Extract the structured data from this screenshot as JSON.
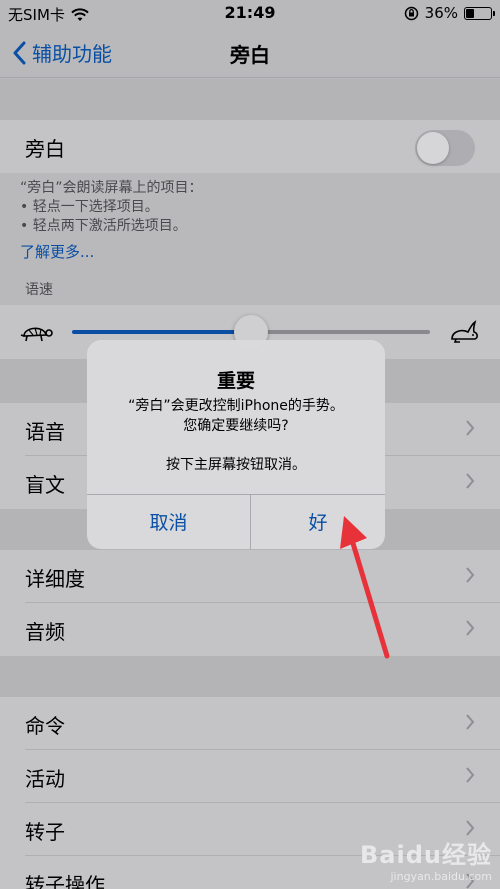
{
  "status_bar": {
    "carrier": "无SIM卡",
    "time": "21:49",
    "battery_percent": "36%",
    "battery_level": 0.36,
    "icons": [
      "wifi-icon",
      "orientation-lock-icon",
      "battery-icon"
    ]
  },
  "nav": {
    "back_label": "辅助功能",
    "title": "旁白"
  },
  "voiceover_row": {
    "label": "旁白",
    "toggle_on": false
  },
  "footer": {
    "line1": "“旁白”会朗读屏幕上的项目：",
    "line2": "• 轻点一下选择项目。",
    "line3": "• 轻点两下激活所选项目。",
    "learn_more": "了解更多..."
  },
  "speaking_rate": {
    "label": "语速",
    "value": 0.5
  },
  "rows_group1": [
    {
      "label": "语音"
    },
    {
      "label": "盲文"
    }
  ],
  "rows_group2": [
    {
      "label": "详细度"
    },
    {
      "label": "音频"
    }
  ],
  "rows_group3": [
    {
      "label": "命令"
    },
    {
      "label": "活动"
    },
    {
      "label": "转子"
    },
    {
      "label": "转子操作"
    }
  ],
  "alert": {
    "title": "重要",
    "message_line1": "“旁白”会更改控制iPhone的手势。",
    "message_line2": "您确定要继续吗?",
    "message_line3": "按下主屏幕按钮取消。",
    "cancel_label": "取消",
    "ok_label": "好"
  },
  "watermark": {
    "brand": "Baidu经验",
    "site": "jingyan.baidu.com"
  },
  "colors": {
    "accent": "#0a4fa3",
    "annotation_arrow": "#e8323a"
  }
}
